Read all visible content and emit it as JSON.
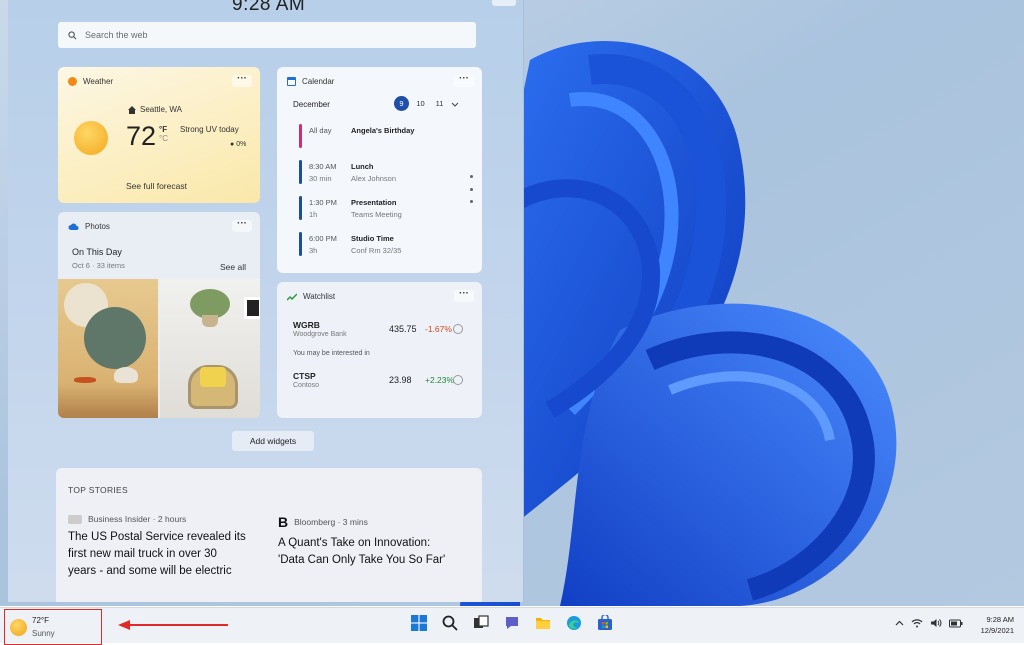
{
  "panel": {
    "clock": "9:28 AM",
    "search_placeholder": "Search the web"
  },
  "weather": {
    "title": "Weather",
    "location": "Seattle, WA",
    "temp": "72",
    "unit_f": "°F",
    "unit_c": "°C",
    "condition": "Strong UV today",
    "precip": "0%",
    "forecast_link": "See full forecast"
  },
  "calendar": {
    "title": "Calendar",
    "month": "December",
    "days": [
      "9",
      "10",
      "11"
    ],
    "events": [
      {
        "time": "All day",
        "duration": "",
        "title": "Angela's Birthday",
        "sub": "",
        "color": "#d0306a"
      },
      {
        "time": "8:30 AM",
        "duration": "30 min",
        "title": "Lunch",
        "sub": "Alex Johnson",
        "color": "#1e4d9a"
      },
      {
        "time": "1:30 PM",
        "duration": "1h",
        "title": "Presentation",
        "sub": "Teams Meeting",
        "color": "#1e4d9a"
      },
      {
        "time": "6:00 PM",
        "duration": "3h",
        "title": "Studio Time",
        "sub": "Conf Rm 32/35",
        "color": "#1e4d9a"
      }
    ]
  },
  "photos": {
    "title": "Photos",
    "heading": "On This Day",
    "sub": "Oct 6 · 33 items",
    "see_all": "See all"
  },
  "watchlist": {
    "title": "Watchlist",
    "stocks": [
      {
        "symbol": "WGRB",
        "name": "Woodgrove Bank",
        "price": "435.75",
        "change": "-1.67%",
        "color": "#d04a1c"
      },
      {
        "symbol": "CTSP",
        "name": "Contoso",
        "price": "23.98",
        "change": "+2.23%",
        "color": "#1d8a3a"
      }
    ],
    "interest_label": "You may be interested in"
  },
  "add_widgets": "Add widgets",
  "top_stories": {
    "heading": "TOP STORIES",
    "stories": [
      {
        "source": "Business Insider · 2 hours",
        "headline": "The US Postal Service revealed its first new mail truck in over 30 years - and some will be electric"
      },
      {
        "source": "Bloomberg · 3 mins",
        "headline": "A Quant's Take on Innovation: 'Data Can Only Take You So Far'"
      }
    ]
  },
  "taskbar": {
    "weather_temp": "72°F",
    "weather_cond": "Sunny",
    "time": "9:28 AM",
    "date": "12/9/2021",
    "icons": [
      "windows-start-icon",
      "search-icon",
      "task-view-icon",
      "chat-icon",
      "file-explorer-icon",
      "edge-browser-icon",
      "store-icon"
    ]
  }
}
